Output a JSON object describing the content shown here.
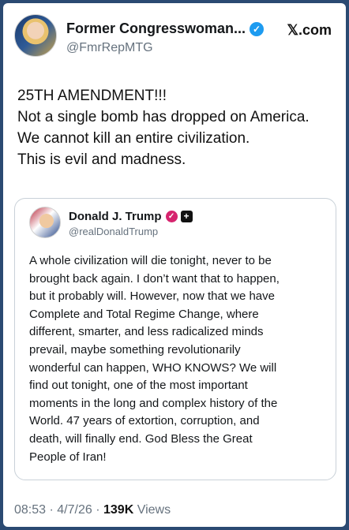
{
  "post": {
    "display_name": "Former Congresswoman...",
    "handle": "@FmrRepMTG",
    "source": "𝕏.com",
    "lines": [
      "25TH AMENDMENT!!!",
      "Not a single bomb has dropped on America.",
      "We cannot kill an entire civilization.",
      "This is evil and madness."
    ],
    "time": "08:53",
    "date": "4/7/26",
    "views_count": "139K",
    "views_label": "Views"
  },
  "quote": {
    "display_name": "Donald J. Trump",
    "handle": "@realDonaldTrump",
    "lines": [
      "A whole civilization will die tonight, never to be",
      "brought back again. I don’t want that to happen,",
      "but it probably will. However, now that we have",
      "Complete and Total Regime Change, where",
      "different, smarter, and less radicalized minds",
      "prevail, maybe something revolutionarily",
      "wonderful can happen, WHO KNOWS? We will",
      "find out tonight, one of the most important",
      "moments in the long and complex history of the",
      "World. 47 years of extortion, corruption, and",
      "death, will finally end. God Bless the Great",
      "People of Iran!"
    ]
  },
  "icons": {
    "verified": "verified-badge-icon",
    "pink_badge": "verified-pink-icon",
    "square_badge": "plus-square-icon"
  },
  "colors": {
    "background": "#2b4a72",
    "verified_blue": "#1d9bf0",
    "muted_text": "#66727e"
  }
}
